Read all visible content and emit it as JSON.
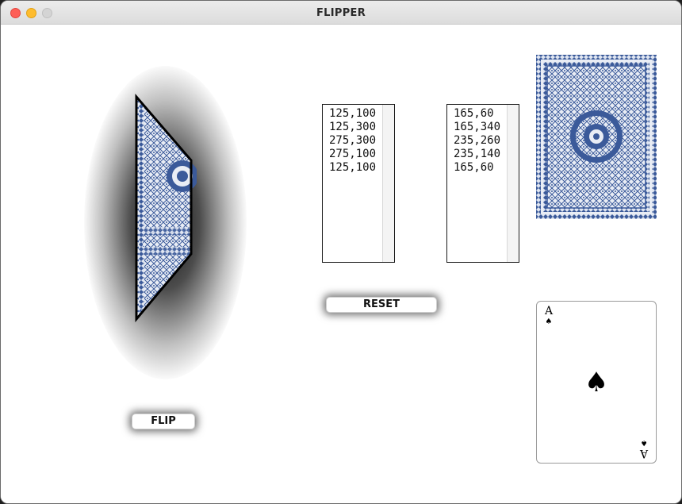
{
  "window": {
    "title": "FLIPPER"
  },
  "lists": {
    "left": [
      "125,100",
      "125,300",
      "275,300",
      "275,100",
      "125,100"
    ],
    "right": [
      "165,60",
      "165,340",
      "235,260",
      "235,140",
      "165,60"
    ]
  },
  "buttons": {
    "reset_label": "RESET",
    "flip_label": "FLIP"
  },
  "ace_card": {
    "rank": "A",
    "suit_symbol": "♠",
    "suit_icon": "spade-icon"
  },
  "colors": {
    "card_back_blue": "#3b5a9a",
    "card_back_light": "#e9edf5"
  }
}
